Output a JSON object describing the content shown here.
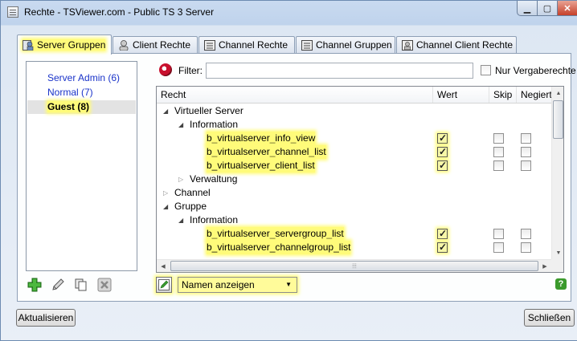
{
  "window": {
    "title": "Rechte - TSViewer.com - Public TS 3 Server"
  },
  "tabs": [
    {
      "label": "Server Gruppen",
      "active": true
    },
    {
      "label": "Client Rechte"
    },
    {
      "label": "Channel Rechte"
    },
    {
      "label": "Channel Gruppen"
    },
    {
      "label": "Channel Client Rechte"
    }
  ],
  "groups": [
    {
      "label": "Server Admin (6)"
    },
    {
      "label": "Normal (7)"
    },
    {
      "label": "Guest (8)",
      "selected": true
    }
  ],
  "filter": {
    "label": "Filter:",
    "value": "",
    "only_granted_label": "Nur Vergaberechte"
  },
  "table": {
    "headers": {
      "recht": "Recht",
      "wert": "Wert",
      "skip": "Skip",
      "negiert": "Negiert"
    },
    "rows": [
      {
        "label": "Virtueller Server",
        "expanded": true
      },
      {
        "label": "Information",
        "expanded": true
      },
      {
        "label": "b_virtualserver_info_view",
        "wert": true,
        "skip": false,
        "negiert": false
      },
      {
        "label": "b_virtualserver_channel_list",
        "wert": true,
        "skip": false,
        "negiert": false
      },
      {
        "label": "b_virtualserver_client_list",
        "wert": true,
        "skip": false,
        "negiert": false
      },
      {
        "label": "Verwaltung",
        "expanded": false
      },
      {
        "label": "Channel",
        "expanded": false
      },
      {
        "label": "Gruppe",
        "expanded": true
      },
      {
        "label": "Information",
        "expanded": true
      },
      {
        "label": "b_virtualserver_servergroup_list",
        "wert": true,
        "skip": false,
        "negiert": false
      },
      {
        "label": "b_virtualserver_channelgroup_list",
        "wert": true,
        "skip": false,
        "negiert": false
      }
    ]
  },
  "view_mode": {
    "selected": "Namen anzeigen"
  },
  "buttons": {
    "refresh": "Aktualisieren",
    "close": "Schließen"
  },
  "icons": {
    "window_controls": [
      "minimize-icon",
      "maximize-icon",
      "close-icon"
    ],
    "left_toolbar": [
      "add-icon",
      "edit-icon",
      "copy-icon",
      "delete-icon"
    ]
  },
  "colors": {
    "highlight": "#fffb7a",
    "link": "#1a33c9"
  }
}
